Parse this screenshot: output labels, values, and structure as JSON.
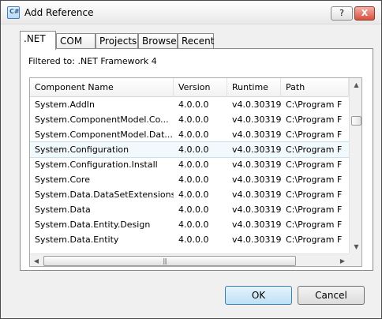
{
  "window": {
    "title": "Add Reference",
    "icon_label": "C#"
  },
  "titlebar_buttons": {
    "help": "?",
    "close": "X"
  },
  "tabs": [
    {
      "label": ".NET",
      "active": true
    },
    {
      "label": "COM",
      "active": false
    },
    {
      "label": "Projects",
      "active": false
    },
    {
      "label": "Browse",
      "active": false
    },
    {
      "label": "Recent",
      "active": false
    }
  ],
  "filter_label": "Filtered to: .NET Framework 4",
  "list": {
    "columns": [
      "Component Name",
      "Version",
      "Runtime",
      "Path"
    ],
    "rows": [
      {
        "name": "System.AddIn",
        "version": "4.0.0.0",
        "runtime": "v4.0.30319",
        "path": "C:\\Program F",
        "selected": false
      },
      {
        "name": "System.ComponentModel.Co...",
        "version": "4.0.0.0",
        "runtime": "v4.0.30319",
        "path": "C:\\Program F",
        "selected": false
      },
      {
        "name": "System.ComponentModel.Dat...",
        "version": "4.0.0.0",
        "runtime": "v4.0.30319",
        "path": "C:\\Program F",
        "selected": false
      },
      {
        "name": "System.Configuration",
        "version": "4.0.0.0",
        "runtime": "v4.0.30319",
        "path": "C:\\Program F",
        "selected": true
      },
      {
        "name": "System.Configuration.Install",
        "version": "4.0.0.0",
        "runtime": "v4.0.30319",
        "path": "C:\\Program F",
        "selected": false
      },
      {
        "name": "System.Core",
        "version": "4.0.0.0",
        "runtime": "v4.0.30319",
        "path": "C:\\Program F",
        "selected": false
      },
      {
        "name": "System.Data.DataSetExtensions",
        "version": "4.0.0.0",
        "runtime": "v4.0.30319",
        "path": "C:\\Program F",
        "selected": false
      },
      {
        "name": "System.Data",
        "version": "4.0.0.0",
        "runtime": "v4.0.30319",
        "path": "C:\\Program F",
        "selected": false
      },
      {
        "name": "System.Data.Entity.Design",
        "version": "4.0.0.0",
        "runtime": "v4.0.30319",
        "path": "C:\\Program F",
        "selected": false
      },
      {
        "name": "System.Data.Entity",
        "version": "4.0.0.0",
        "runtime": "v4.0.30319",
        "path": "C:\\Program F",
        "selected": false
      }
    ]
  },
  "buttons": {
    "ok": "OK",
    "cancel": "Cancel"
  }
}
